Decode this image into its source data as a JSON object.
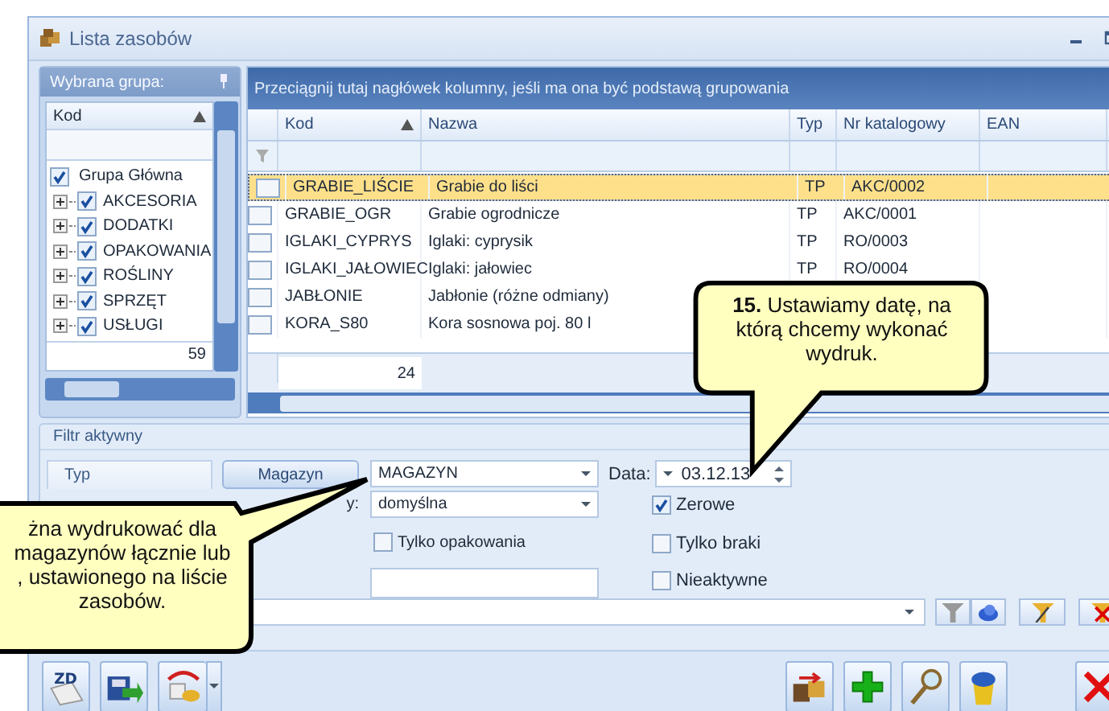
{
  "window": {
    "title": "Lista zasobów"
  },
  "group_panel": {
    "title": "Wybrana grupa:",
    "column": {
      "label": "Kod",
      "sorted": true
    },
    "count": "59",
    "tree": [
      {
        "label": "Grupa Główna",
        "checked": true,
        "children": [
          {
            "label": "AKCESORIA",
            "checked": true,
            "expanded": false
          },
          {
            "label": "DODATKI",
            "checked": true,
            "expanded": false
          },
          {
            "label": "OPAKOWANIA",
            "checked": true,
            "expanded": false
          },
          {
            "label": "ROŚLINY",
            "checked": true,
            "expanded": false
          },
          {
            "label": "SPRZĘT",
            "checked": true,
            "expanded": false
          },
          {
            "label": "USŁUGI",
            "checked": true,
            "expanded": false
          }
        ]
      }
    ]
  },
  "grid": {
    "group_hint": "Przeciągnij tutaj nagłówek kolumny, jeśli ma ona być podstawą grupowania",
    "columns": [
      {
        "label": "Kod",
        "sorted": true
      },
      {
        "label": "Nazwa",
        "sorted": false
      },
      {
        "label": "Typ",
        "sorted": false
      },
      {
        "label": "Nr katalogowy",
        "sorted": false
      },
      {
        "label": "EAN",
        "sorted": false
      }
    ],
    "rows": [
      {
        "selected": true,
        "checked": false,
        "cells": [
          "GRABIE_LIŚCIE",
          "Grabie do liści",
          "TP",
          "AKC/0002"
        ]
      },
      {
        "selected": false,
        "checked": false,
        "cells": [
          "GRABIE_OGR",
          "Grabie ogrodnicze",
          "TP",
          "AKC/0001"
        ]
      },
      {
        "selected": false,
        "checked": false,
        "cells": [
          "IGLAKI_CYPRYS",
          "Iglaki: cyprysik",
          "TP",
          "RO/0003"
        ]
      },
      {
        "selected": false,
        "checked": false,
        "cells": [
          "IGLAKI_JAŁOWIEC",
          "Iglaki: jałowiec",
          "TP",
          "RO/0004"
        ]
      },
      {
        "selected": false,
        "checked": false,
        "cells": [
          "JABŁONIE",
          "Jabłonie (różne odmiany)"
        ]
      },
      {
        "selected": false,
        "checked": false,
        "cells": [
          "KORA_S80",
          "Kora sosnowa poj. 80 l"
        ]
      }
    ],
    "count": "24"
  },
  "filter": {
    "title": "Filtr aktywny",
    "type_header": "Typ",
    "warehouse_button": "Magazyn",
    "warehouse": "MAGAZYN",
    "price_label": "y:",
    "price": "domyślna",
    "date_label": "Data:",
    "date": "03.12.13",
    "packaging": {
      "label": "Tylko opakowania",
      "checked": false
    },
    "options": [
      {
        "label": "Zerowe",
        "checked": true
      },
      {
        "label": "Tylko braki",
        "checked": false
      },
      {
        "label": "Nieaktywne",
        "checked": false
      }
    ]
  },
  "callouts": [
    {
      "text": "**15.** Ustawiamy datę, na którą chcemy wykonać wydruk."
    },
    {
      "lines": [
        "żna wydrukować dla",
        "magazynów łącznie lub",
        ", ustawionego na liście",
        "zasobów."
      ]
    }
  ],
  "toolbar": {
    "zd_label": "ZD"
  }
}
